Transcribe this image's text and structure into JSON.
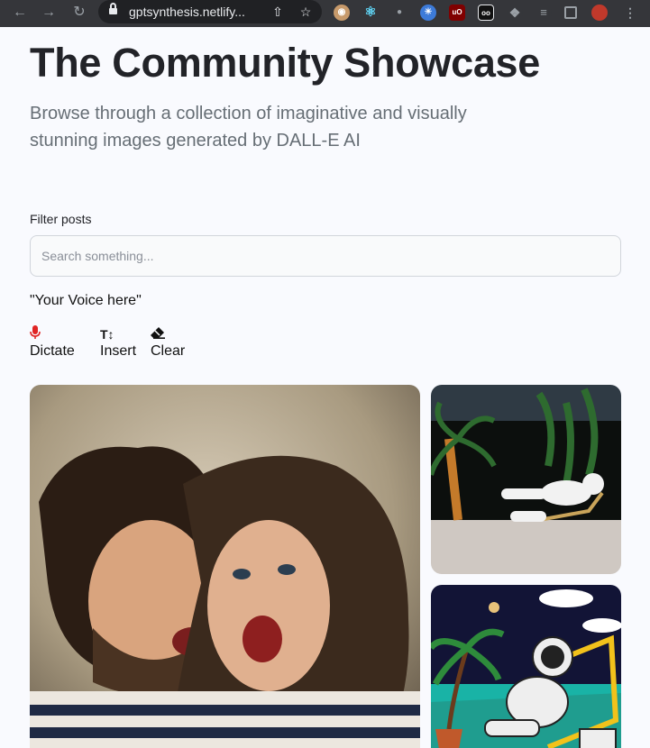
{
  "browser": {
    "url": "gptsynthesis.netlify...",
    "icons": {
      "back": "back-arrow-icon",
      "forward": "forward-arrow-icon",
      "reload": "reload-icon",
      "share": "share-icon",
      "bookmark": "star-icon"
    },
    "extensions": {
      "ublock_label": "uO",
      "adblock_label": "oo"
    }
  },
  "header": {
    "title": "The Community Showcase",
    "subtitle": "Browse through a collection of imaginative and visually stunning images generated by DALL-E AI"
  },
  "filter": {
    "label": "Filter posts",
    "placeholder": "Search something..."
  },
  "voice": {
    "transcript": "\"Your Voice here\"",
    "buttons": {
      "dictate": "Dictate",
      "insert": "Insert",
      "clear": "Clear"
    },
    "icon_glyphs": {
      "insert": "T↕"
    }
  },
  "gallery": {
    "cards": [
      {
        "subject": "couple-screaming-photo"
      },
      {
        "subject": "astronaut-lounging-by-palm-photo"
      },
      {
        "subject": "astronaut-cartoon-illustration"
      }
    ]
  },
  "colors": {
    "page_background": "#f9fafe",
    "title": "#222328",
    "subtitle": "#666e75",
    "mic_accent": "#e02424"
  }
}
